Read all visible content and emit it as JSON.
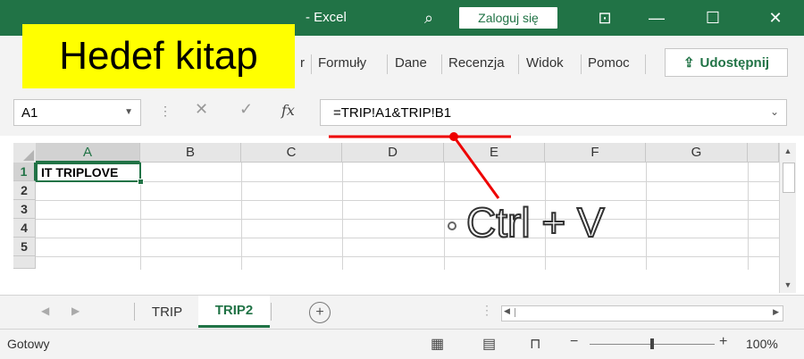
{
  "titlebar": {
    "app_title": "- Excel",
    "login_label": "Zaloguj się",
    "search_icon": "search-icon",
    "accent": "#217346"
  },
  "overlay": {
    "label": "Hedef kitap",
    "color": "#ffff00"
  },
  "ribbon": {
    "tabs": [
      {
        "label": "r"
      },
      {
        "label": "Formuły"
      },
      {
        "label": "Dane"
      },
      {
        "label": "Recenzja"
      },
      {
        "label": "Widok"
      },
      {
        "label": "Pomoc"
      }
    ],
    "share_label": "Udostępnij"
  },
  "formula_bar": {
    "name_box": "A1",
    "formula": "=TRIP!A1&TRIP!B1",
    "fx": "fx"
  },
  "grid": {
    "columns": [
      "A",
      "B",
      "C",
      "D",
      "E",
      "F",
      "G"
    ],
    "rows": [
      "1",
      "2",
      "3",
      "4",
      "5"
    ],
    "cells": {
      "A1": "IT TRIPLOVE"
    },
    "selected_cell": "A1"
  },
  "sheets": {
    "tabs": [
      {
        "label": "TRIP"
      },
      {
        "label": "TRIP2"
      }
    ],
    "active": "TRIP2"
  },
  "status": {
    "text": "Gotowy",
    "zoom": "100%"
  },
  "annotation": {
    "text": "Ctrl + V",
    "line_color": "#ee0000"
  }
}
